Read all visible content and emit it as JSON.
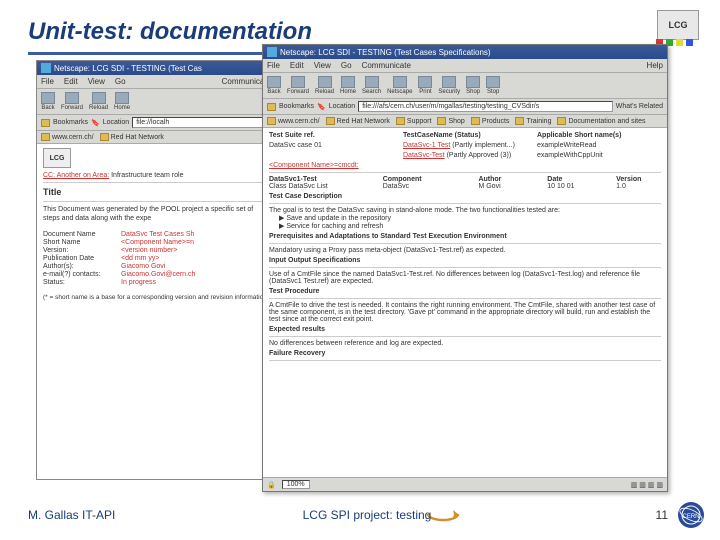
{
  "slide": {
    "title": "Unit-test: documentation",
    "footer_left": "M. Gallas   IT-API",
    "footer_center": "LCG SPI project: testing",
    "page_num": "11"
  },
  "logo": {
    "text": "LCG"
  },
  "winBack": {
    "title": "Netscape: LCG SDI - TESTING (Test Cas",
    "menu": [
      "File",
      "Edit",
      "View",
      "Go",
      "Communicate"
    ],
    "tools": [
      "Back",
      "Forward",
      "Reload",
      "Home"
    ],
    "loc_label": "Bookmarks",
    "loc_value": "file://localh",
    "bookmarks": [
      "www.cern.ch/",
      "Red Hat Network"
    ],
    "lcg": "LCG",
    "cc_line": "CC: Another on Area:",
    "cc_val": "Infrastructure team role",
    "heading": "Title",
    "para": "This Document was generated by the POOL project a specific set of steps and data along with the expe",
    "pairs": [
      {
        "k": "Document Name",
        "v": "DataSvc Test Cases Sh"
      },
      {
        "k": "Short Name",
        "v": "<Component Name>=n"
      },
      {
        "k": "Version:",
        "v": "<version number>"
      },
      {
        "k": "Publication Date",
        "v": "<dd mm yy>"
      },
      {
        "k": "Author(s):",
        "v": "Giacomo Govi"
      },
      {
        "k": "e-mail(?) contacts:",
        "v": "Giacomo.Govi@cern.ch"
      },
      {
        "k": "Status:",
        "v": "In progress"
      }
    ],
    "foot": "(* = short name is a base for a corresponding version and revision information)"
  },
  "winFront": {
    "title": "Netscape: LCG SDI - TESTING (Test Cases Specifications)",
    "menu": [
      "File",
      "Edit",
      "View",
      "Go",
      "Communicate",
      "Help"
    ],
    "tools": [
      "Back",
      "Forward",
      "Reload",
      "Home",
      "Search",
      "Netscape",
      "Print",
      "Security",
      "Shop",
      "Stop"
    ],
    "loc_label": "Bookmarks",
    "loc_icon": "location-icon",
    "loc_value": "file:///afs/cern.ch/user/m/mgallas/testing/testing_CVSdir/s",
    "loc_right": "What's Related",
    "bookmarks": [
      "www.cern.ch/",
      "Red Hat Network",
      "Support",
      "Shop",
      "Products",
      "Training",
      "Documentation and sites"
    ],
    "hdr": {
      "c1": "Test Suite ref.",
      "c2": "TestCaseName (Status)",
      "c3": "Applicable Short name(s)"
    },
    "rows": [
      {
        "c1": "DataSvc case 01",
        "c2": "DataSvc-1 Test",
        "c2b": "(Partly implement...)",
        "c3": "exampleWriteRead"
      },
      {
        "c1": "",
        "c2": "DataSvc-Test",
        "c2b": "(Partly Approved (3))",
        "c3": "exampleWithCppUnit"
      }
    ],
    "comp_line": "<Component Name>=cmcdt:",
    "detail": {
      "h1": "DataSvc1-Test",
      "h2": "Component",
      "h3": "Author",
      "h4": "Date",
      "h5": "Version",
      "v1": "Class DataSvc List",
      "v2": "DataSvc",
      "v3": "M Govi",
      "v4": "10 10 01",
      "v5": "1.0"
    },
    "sec1": "Test Case Description",
    "desc": "The goal is to test the DataSvc saving in stand-alone mode. The two functionalities tested are:",
    "bul1": "▶ Save and update in the repository",
    "bul2": "▶ Service for caching and refresh",
    "sec2": "Prerequisites and Adaptations to Standard Test Execution Environment",
    "p2": "Mandatory using a Proxy pass meta-object (DataSvc1-Test.ref) as expected.",
    "sec3": "Input Output Specifications",
    "p3": "Use of a CmtFile since the named DataSvc1-Test.ref. No differences between log (DataSvc1-Test.log) and reference file (DataSvc1 Test.ref) are expected.",
    "sec4": "Test Procedure",
    "p4": "A CmtFile to drive the test is needed. It contains the right running environment. The CmtFile, shared with another test case of the same component, is in the test directory. 'Gave pt' command in the appropriate directory will build, run and establish the test since at the correct exit point.",
    "sec5": "Expected results",
    "p5": "No differences between reference and log are expected.",
    "sec6": "Failure Recovery",
    "status_pct": "100%"
  }
}
